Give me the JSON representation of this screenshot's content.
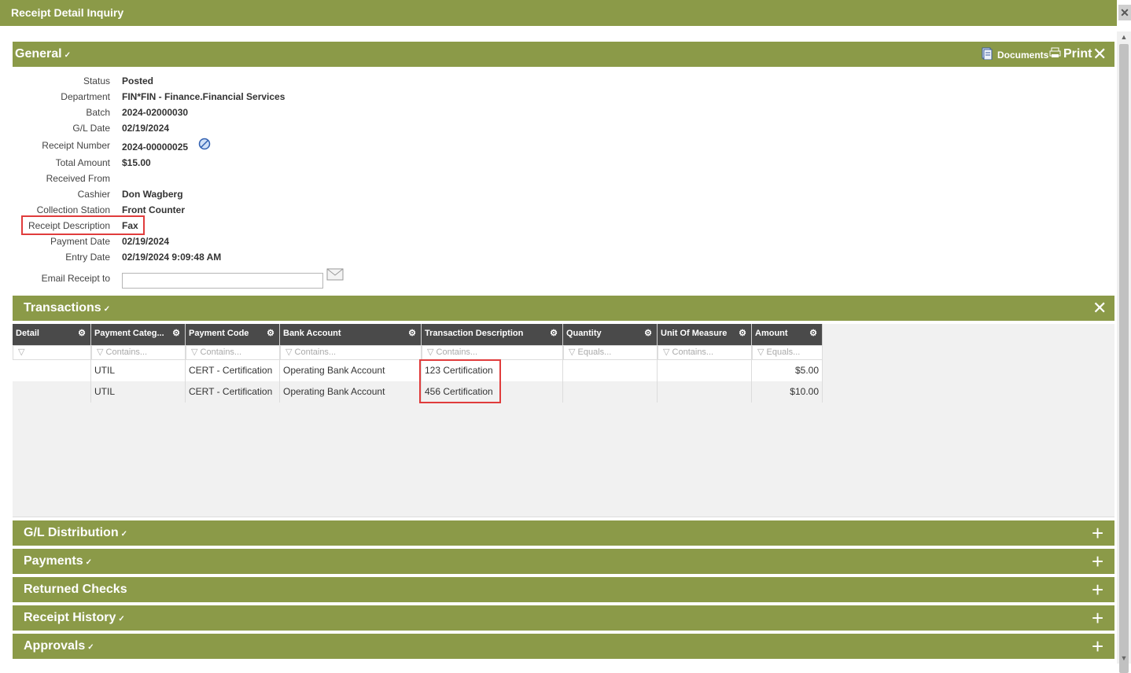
{
  "window": {
    "title": "Receipt Detail Inquiry"
  },
  "general": {
    "title": "General",
    "documents_label": "Documents",
    "print_label": "Print",
    "fields": [
      {
        "label": "Status",
        "value": "Posted"
      },
      {
        "label": "Department",
        "value": "FIN*FIN - Finance.Financial Services"
      },
      {
        "label": "Batch",
        "value": "2024-02000030"
      },
      {
        "label": "G/L Date",
        "value": "02/19/2024"
      },
      {
        "label": "Receipt Number",
        "value": "2024-00000025"
      },
      {
        "label": "Total Amount",
        "value": "$15.00"
      },
      {
        "label": "Received From",
        "value": ""
      },
      {
        "label": "Cashier",
        "value": "Don Wagberg"
      },
      {
        "label": "Collection Station",
        "value": "Front Counter"
      },
      {
        "label": "Receipt Description",
        "value": "Fax"
      },
      {
        "label": "Payment Date",
        "value": "02/19/2024"
      },
      {
        "label": "Entry Date",
        "value": "02/19/2024 9:09:48 AM"
      }
    ],
    "email_label": "Email Receipt to",
    "email_value": ""
  },
  "transactions": {
    "title": "Transactions",
    "columns": [
      "Detail",
      "Payment Categ...",
      "Payment Code",
      "Bank Account",
      "Transaction Description",
      "Quantity",
      "Unit Of Measure",
      "Amount"
    ],
    "filters": [
      "",
      "Contains...",
      "Contains...",
      "Contains...",
      "Contains...",
      "Equals...",
      "Contains...",
      "Equals..."
    ],
    "rows": [
      {
        "detail": "",
        "category": "UTIL",
        "code": "CERT - Certification",
        "bank": "Operating Bank Account",
        "description": "123 Certification",
        "quantity": "",
        "uom": "",
        "amount": "$5.00"
      },
      {
        "detail": "",
        "category": "UTIL",
        "code": "CERT - Certification",
        "bank": "Operating Bank Account",
        "description": "456 Certification",
        "quantity": "",
        "uom": "",
        "amount": "$10.00"
      }
    ]
  },
  "sections": [
    {
      "title": "G/L Distribution",
      "chevron": true
    },
    {
      "title": "Payments",
      "chevron": true
    },
    {
      "title": "Returned Checks",
      "chevron": false
    },
    {
      "title": "Receipt History",
      "chevron": true
    },
    {
      "title": "Approvals",
      "chevron": true
    }
  ],
  "colors": {
    "accent": "#8b9a48",
    "grid_header": "#4a4a4a",
    "highlight": "#e03c3c"
  }
}
